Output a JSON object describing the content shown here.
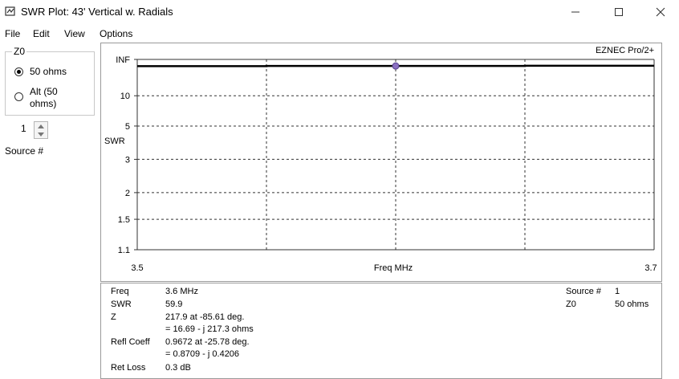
{
  "window": {
    "title": "SWR Plot: 43' Vertical w. Radials",
    "minimize_icon": "minimize-icon",
    "maximize_icon": "maximize-icon",
    "close_icon": "close-icon"
  },
  "menu": [
    "File",
    "Edit",
    "View",
    "Options"
  ],
  "z0": {
    "legend": "Z0",
    "option1": "50 ohms",
    "option2_line1": "Alt (50",
    "option2_line2": "ohms)",
    "selected": "50 ohms"
  },
  "source": {
    "value": "1",
    "label": "Source #"
  },
  "chart_data": {
    "type": "line",
    "brand": "EZNEC Pro/2+",
    "xlabel": "Freq MHz",
    "ylabel": "SWR",
    "x_ticks": [
      "3.5",
      "3.7"
    ],
    "x_range": [
      3.5,
      3.7
    ],
    "y_ticks": [
      "INF",
      "10",
      "5",
      "3",
      "2",
      "1.5",
      "1.1"
    ],
    "y_scale": "reflection coefficient (SWR)",
    "grid": true,
    "grid_style": "dashed",
    "x_gridlines": [
      3.55,
      3.6,
      3.65
    ],
    "series": [
      {
        "x": [
          3.5,
          3.6,
          3.7
        ],
        "y": [
          58.2,
          59.9,
          61.8
        ]
      }
    ],
    "marker": {
      "x": 3.6,
      "y": 59.9,
      "color": "#8a6fc1"
    }
  },
  "info": {
    "freq_label": "Freq",
    "freq_value": "3.6 MHz",
    "swr_label": "SWR",
    "swr_value": "59.9",
    "z_label": "Z",
    "z_value1": "217.9 at -85.61 deg.",
    "z_value2": "= 16.69 - j 217.3 ohms",
    "refl_label": "Refl Coeff",
    "refl_value1": "0.9672 at -25.78 deg.",
    "refl_value2": "= 0.8709 - j 0.4206",
    "ret_label": "Ret Loss",
    "ret_value": "0.3 dB",
    "source_label": "Source #",
    "source_value": "1",
    "z0_label": "Z0",
    "z0_value": "50 ohms"
  }
}
